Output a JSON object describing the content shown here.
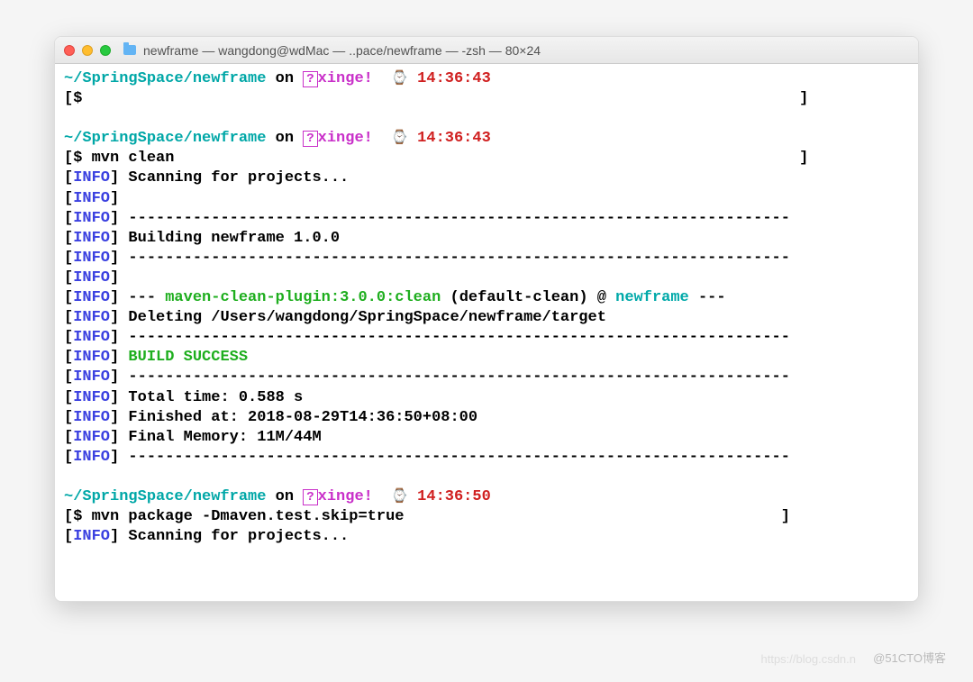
{
  "window": {
    "title": "newframe — wangdong@wdMac — ..pace/newframe — -zsh — 80×24"
  },
  "prompt": {
    "path": "~/SpringSpace/newframe",
    "on": " on ",
    "q": "?",
    "branch": "xinge!",
    "watch": "⌚",
    "t1": "14:36:43",
    "t2": "14:36:43",
    "t3": "14:36:50",
    "ps": "$ ",
    "lbr": "[",
    "rbr": "]"
  },
  "cmd": {
    "empty": "",
    "clean": "mvn clean",
    "pkg": "mvn package -Dmaven.test.skip=true"
  },
  "info": {
    "lb": "[",
    "tag": "INFO",
    "rb": "] ",
    "rbnl": "]",
    "dash": "------------------------------------------------------------------------",
    "scan": "Scanning for projects...",
    "build": "Building newframe 1.0.0",
    "plugdash1": "--- ",
    "plugname": "maven-clean-plugin:3.0.0:clean",
    "plugmid": " (default-clean) @ ",
    "plugproj": "newframe",
    "plugdash2": " ---",
    "delete": "Deleting /Users/wangdong/SpringSpace/newframe/target",
    "success": "BUILD SUCCESS",
    "total": "Total time: 0.588 s",
    "finished": "Finished at: 2018-08-29T14:36:50+08:00",
    "memory": "Final Memory: 11M/44M"
  },
  "watermark": {
    "right": "@51CTO博客",
    "left": "https://blog.csdn.n"
  }
}
